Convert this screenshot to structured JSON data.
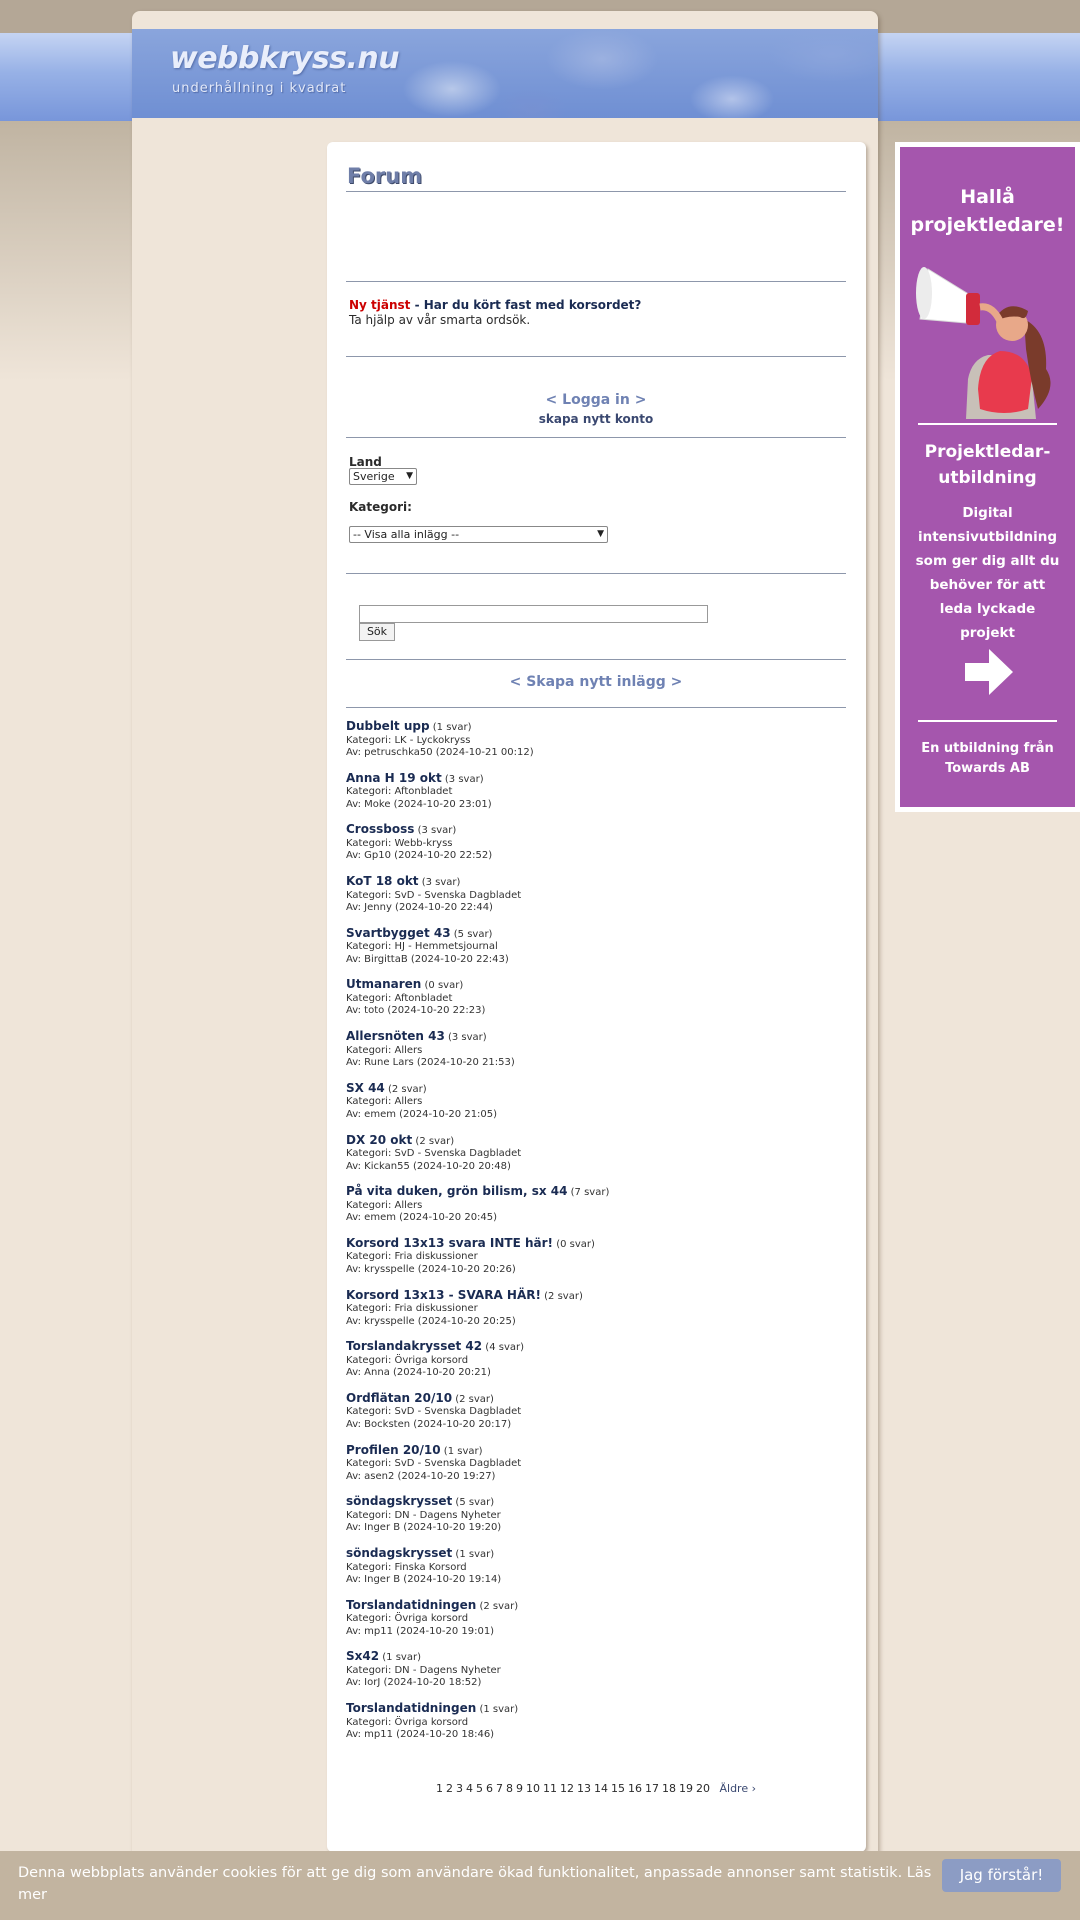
{
  "site": {
    "logo_title": "webbkryss.nu",
    "logo_subtitle": "underhållning i kvadrat"
  },
  "forum": {
    "title": "Forum",
    "promo_new": "Ny tjänst",
    "promo_title": " - Har du kört fast med korsordet?",
    "promo_text": "Ta hjälp av vår smarta ordsök.",
    "login_label": "< Logga in >",
    "signup_label": "skapa nytt konto",
    "country_label": "Land",
    "country_value": "Sverige",
    "category_label": "Kategori:",
    "category_value": "-- Visa alla inlägg --",
    "search_button": "Sök",
    "new_post_label": "< Skapa nytt inlägg >"
  },
  "posts": [
    {
      "title": "Dubbelt upp",
      "count": "(1 svar)",
      "category": "Kategori: LK - Lyckokryss",
      "author": "Av: petruschka50 (2024-10-21 00:12)"
    },
    {
      "title": "Anna H 19 okt",
      "count": "(3 svar)",
      "category": "Kategori: Aftonbladet",
      "author": "Av: Moke (2024-10-20 23:01)"
    },
    {
      "title": "Crossboss",
      "count": "(3 svar)",
      "category": "Kategori: Webb-kryss",
      "author": "Av: Gp10 (2024-10-20 22:52)"
    },
    {
      "title": "KoT 18 okt",
      "count": "(3 svar)",
      "category": "Kategori: SvD - Svenska Dagbladet",
      "author": "Av: Jenny (2024-10-20 22:44)"
    },
    {
      "title": "Svartbygget 43",
      "count": "(5 svar)",
      "category": "Kategori: HJ - Hemmetsjournal",
      "author": "Av: BirgittaB (2024-10-20 22:43)"
    },
    {
      "title": "Utmanaren",
      "count": "(0 svar)",
      "category": "Kategori: Aftonbladet",
      "author": "Av: toto (2024-10-20 22:23)"
    },
    {
      "title": "Allersnöten 43",
      "count": "(3 svar)",
      "category": "Kategori: Allers",
      "author": "Av: Rune Lars (2024-10-20 21:53)"
    },
    {
      "title": "SX 44",
      "count": "(2 svar)",
      "category": "Kategori: Allers",
      "author": "Av: emem (2024-10-20 21:05)"
    },
    {
      "title": "DX 20 okt",
      "count": "(2 svar)",
      "category": "Kategori: SvD - Svenska Dagbladet",
      "author": "Av: Kickan55 (2024-10-20 20:48)"
    },
    {
      "title": "På vita duken, grön bilism, sx 44",
      "count": "(7 svar)",
      "category": "Kategori: Allers",
      "author": "Av: emem (2024-10-20 20:45)"
    },
    {
      "title": "Korsord 13x13 svara INTE här!",
      "count": "(0 svar)",
      "category": "Kategori: Fria diskussioner",
      "author": "Av: krysspelle (2024-10-20 20:26)"
    },
    {
      "title": "Korsord 13x13 - SVARA HÄR!",
      "count": "(2 svar)",
      "category": "Kategori: Fria diskussioner",
      "author": "Av: krysspelle (2024-10-20 20:25)"
    },
    {
      "title": "Torslandakrysset 42",
      "count": "(4 svar)",
      "category": "Kategori: Övriga korsord",
      "author": "Av: Anna (2024-10-20 20:21)"
    },
    {
      "title": "Ordflätan 20/10",
      "count": "(2 svar)",
      "category": "Kategori: SvD - Svenska Dagbladet",
      "author": "Av: Bocksten (2024-10-20 20:17)"
    },
    {
      "title": "Profilen 20/10",
      "count": "(1 svar)",
      "category": "Kategori: SvD - Svenska Dagbladet",
      "author": "Av: asen2 (2024-10-20 19:27)"
    },
    {
      "title": "söndagskrysset",
      "count": "(5 svar)",
      "category": "Kategori: DN - Dagens Nyheter",
      "author": "Av: Inger B (2024-10-20 19:20)"
    },
    {
      "title": "söndagskrysset",
      "count": "(1 svar)",
      "category": "Kategori: Finska Korsord",
      "author": "Av: Inger B (2024-10-20 19:14)"
    },
    {
      "title": "Torslandatidningen",
      "count": "(2 svar)",
      "category": "Kategori: Övriga korsord",
      "author": "Av: mp11 (2024-10-20 19:01)"
    },
    {
      "title": "Sx42",
      "count": "(1 svar)",
      "category": "Kategori: DN - Dagens Nyheter",
      "author": "Av: IorJ (2024-10-20 18:52)"
    },
    {
      "title": "Torslandatidningen",
      "count": "(1 svar)",
      "category": "Kategori: Övriga korsord",
      "author": "Av: mp11 (2024-10-20 18:46)"
    }
  ],
  "pager": {
    "pages": [
      "1",
      "2",
      "3",
      "4",
      "5",
      "6",
      "7",
      "8",
      "9",
      "10",
      "11",
      "12",
      "13",
      "14",
      "15",
      "16",
      "17",
      "18",
      "19",
      "20"
    ],
    "older": "Äldre ›"
  },
  "ad": {
    "headline_1": "Hallå",
    "headline_2": "projektledare!",
    "product_1": "Projektledar-",
    "product_2": "utbildning",
    "body_1": "Digital",
    "body_2": "intensivutbildning",
    "body_3": "som ger dig allt du",
    "body_4": "behöver för att",
    "body_5": "leda lyckade",
    "body_6": "projekt",
    "footer_1": "En utbildning från",
    "footer_2": "Towards AB",
    "bg_color": "#a556ad",
    "icons": [
      "megaphone-woman-illustration",
      "arrow-right-icon"
    ]
  },
  "cookie": {
    "text": "Denna webbplats använder cookies för att ge dig som användare ökad funktionalitet, anpassade annonser samt statistik. Läs mer",
    "button": "Jag förstår!"
  }
}
